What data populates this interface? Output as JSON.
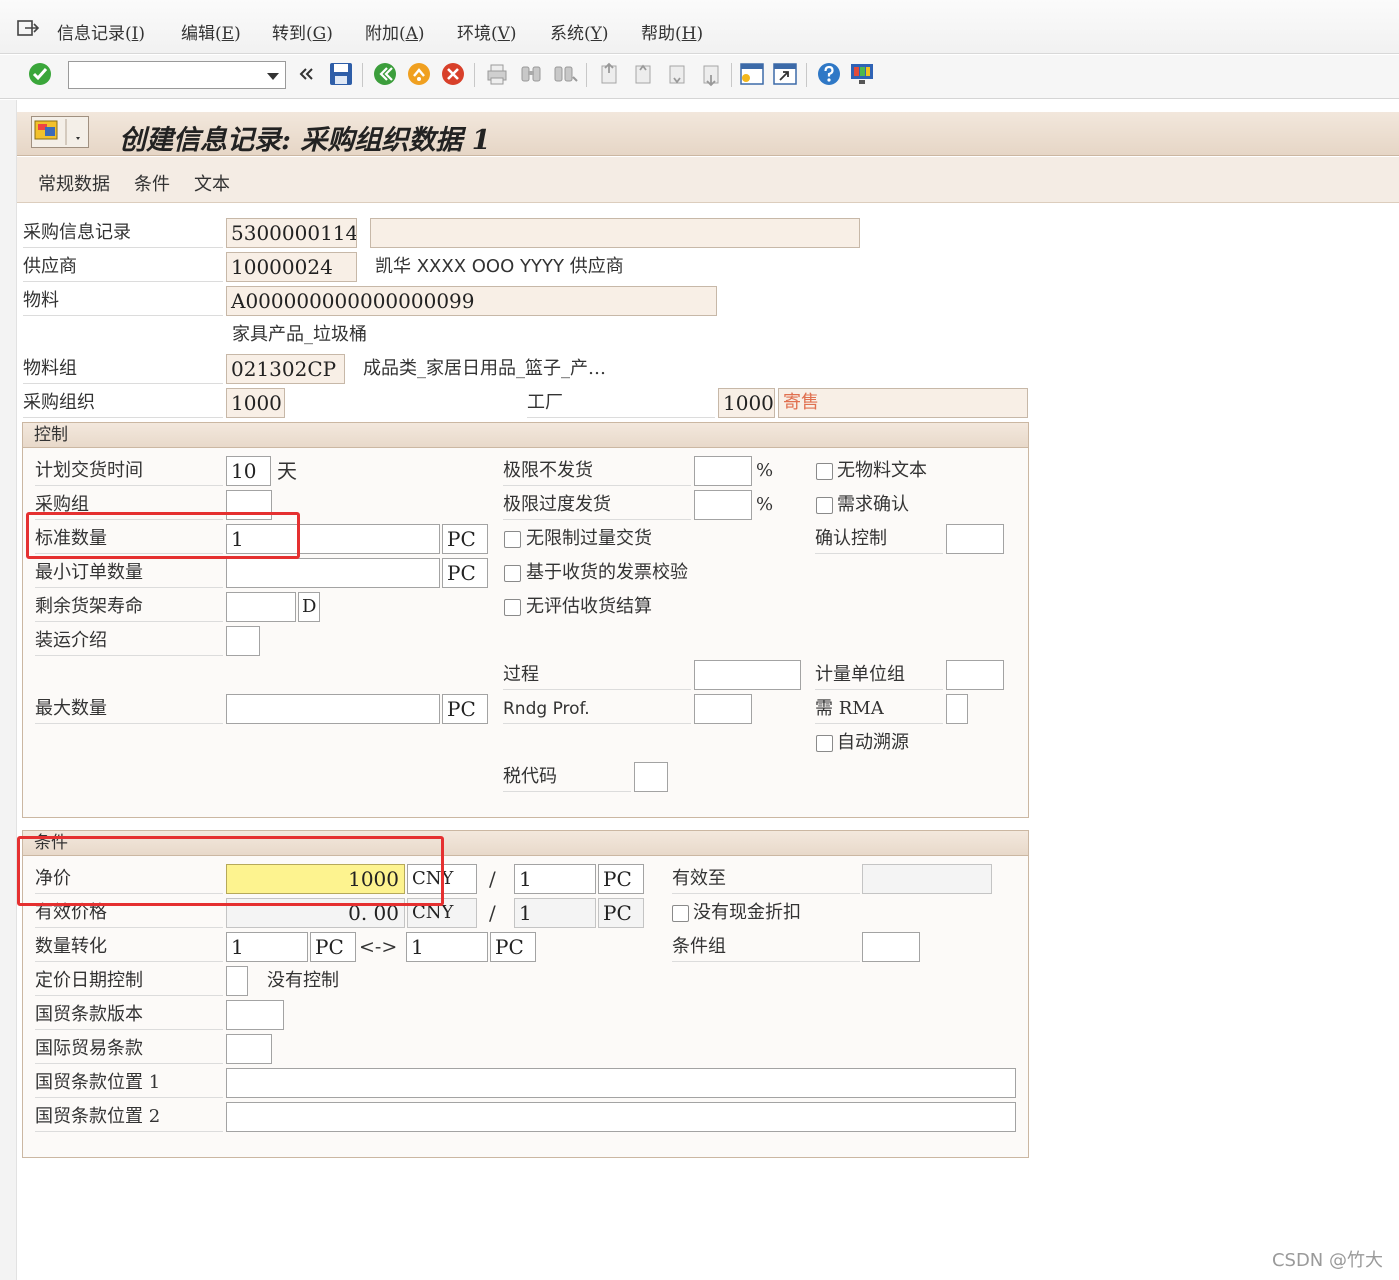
{
  "menu": {
    "items": [
      {
        "label": "信息记录(",
        "key": "I",
        "suffix": ")"
      },
      {
        "label": "编辑(",
        "key": "E",
        "suffix": ")"
      },
      {
        "label": "转到(",
        "key": "G",
        "suffix": ")"
      },
      {
        "label": "附加(",
        "key": "A",
        "suffix": ")"
      },
      {
        "label": "环境(",
        "key": "V",
        "suffix": ")"
      },
      {
        "label": "系统(",
        "key": "Y",
        "suffix": ")"
      },
      {
        "label": "帮助(",
        "key": "H",
        "suffix": ")"
      }
    ]
  },
  "toolbar": {
    "command_value": "",
    "icons": [
      "enter-icon",
      "save-icon",
      "back-icon",
      "exit-icon",
      "cancel-icon",
      "print-icon",
      "find-icon",
      "find-next-icon",
      "first-page-icon",
      "prev-page-icon",
      "next-page-icon",
      "last-page-icon",
      "new-session-icon",
      "shortcut-icon",
      "help-icon",
      "customize-layout-icon"
    ]
  },
  "title": "创建信息记录: 采购组织数据 1",
  "app_toolbar": {
    "general": "常规数据",
    "conditions": "条件",
    "texts": "文本"
  },
  "header": {
    "info_record_label": "采购信息记录",
    "info_record_value": "5300000114",
    "info_record_extra": "",
    "vendor_label": "供应商",
    "vendor_value": "10000024",
    "vendor_name": "凯华 XXXX  OOO  YYYY 供应商",
    "material_label": "物料",
    "material_value": "A000000000000000099",
    "material_desc": "家具产品_垃圾桶",
    "material_group_label": "物料组",
    "material_group_value": "021302CP",
    "material_group_desc": "成品类_家居日用品_篮子_产…",
    "purch_org_label": "采购组织",
    "purch_org_value": "1000",
    "plant_label": "工厂",
    "plant_value": "1000",
    "plant_desc": "寄售"
  },
  "control": {
    "title": "控制",
    "planned_delivery_label": "计划交货时间",
    "planned_delivery_value": "10",
    "planned_delivery_unit": "天",
    "purch_group_label": "采购组",
    "purch_group_value": "",
    "standard_qty_label": "标准数量",
    "standard_qty_value": "1",
    "standard_qty_unit": "PC",
    "min_order_label": "最小订单数量",
    "min_order_value": "",
    "min_order_unit": "PC",
    "shelf_life_label": "剩余货架寿命",
    "shelf_life_value": "",
    "shelf_life_unit": "D",
    "shipping_label": "装运介绍",
    "shipping_value": "",
    "max_qty_label": "最大数量",
    "max_qty_value": "",
    "max_qty_unit": "PC",
    "underdel_label": "极限不发货",
    "underdel_value": "",
    "overdel_label": "极限过度发货",
    "overdel_value": "",
    "percent": "%",
    "unlimited_label": "无限制过量交货",
    "unlimited_checked": false,
    "gr_iv_label": "基于收货的发票校验",
    "gr_iv_checked": false,
    "no_eval_label": "无评估收货结算",
    "no_eval_checked": false,
    "procedure_label": "过程",
    "procedure_value": "",
    "rndg_label": "Rndg Prof.",
    "rndg_value": "",
    "tax_label": "税代码",
    "tax_value": "",
    "no_mat_text_label": "无物料文本",
    "no_mat_text_checked": false,
    "ack_reqd_label": "需求确认",
    "ack_reqd_checked": false,
    "conf_ctrl_label": "确认控制",
    "conf_ctrl_value": "",
    "uom_group_label": "计量单位组",
    "uom_group_value": "",
    "rma_label": "需 RMA",
    "rma_value": "",
    "auto_source_label": "自动溯源",
    "auto_source_checked": false
  },
  "conditions": {
    "title": "条件",
    "net_price_label": "净价",
    "net_price_value": "1000",
    "net_price_currency": "CNY",
    "slash": "/",
    "net_price_per": "1",
    "net_price_uom": "PC",
    "eff_price_label": "有效价格",
    "eff_price_value": "0. 00",
    "eff_price_currency": "CNY",
    "eff_price_per": "1",
    "eff_price_uom": "PC",
    "valid_to_label": "有效至",
    "valid_to_value": "",
    "no_cash_disc_label": "没有现金折扣",
    "no_cash_disc_checked": false,
    "qty_conv_label": "数量转化",
    "qty_conv_left": "1",
    "qty_conv_left_uom": "PC",
    "qty_conv_arrow": "<->",
    "qty_conv_right": "1",
    "qty_conv_right_uom": "PC",
    "cond_group_label": "条件组",
    "cond_group_value": "",
    "pricing_date_label": "定价日期控制",
    "pricing_date_value": "",
    "pricing_date_desc": "没有控制",
    "incoterms_version_label": "国贸条款版本",
    "incoterms_version_value": "",
    "incoterms_label": "国际贸易条款",
    "incoterms_value": "",
    "incoterms_loc1_label": "国贸条款位置 1",
    "incoterms_loc1_value": "",
    "incoterms_loc2_label": "国贸条款位置 2",
    "incoterms_loc2_value": ""
  },
  "watermark": "CSDN @竹大",
  "colors": {
    "highlight": "#e53030",
    "net_price_bg": "#fdf38f",
    "title_bg": "#e8d9ca"
  }
}
